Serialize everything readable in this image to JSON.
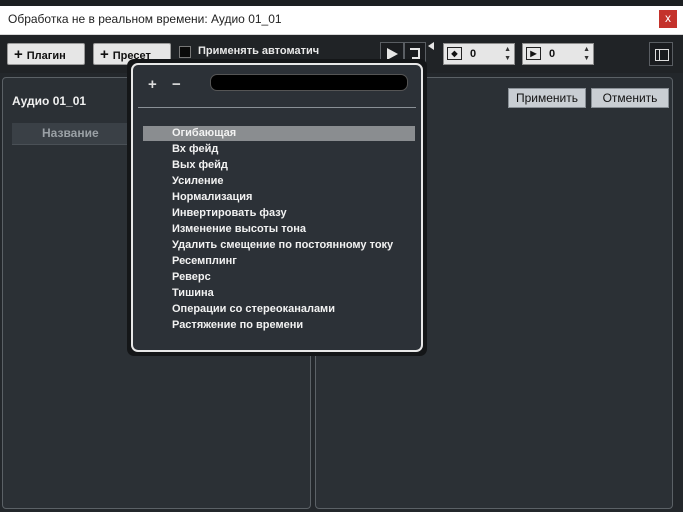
{
  "window": {
    "title": "Обработка не в реальном времени: Аудио 01_01",
    "close_label": "x"
  },
  "toolbar": {
    "plugin_label": "Плагин",
    "preset_label": "Пресет",
    "auto_apply_label": "Применять автоматич",
    "spin1_value": "0",
    "spin2_value": "0"
  },
  "left_panel": {
    "title": "Аудио 01_01",
    "column_header": "Название"
  },
  "right_panel": {
    "apply_label": "Применить",
    "cancel_label": "Отменить"
  },
  "popup": {
    "add_label": "+",
    "remove_label": "−",
    "items": [
      {
        "label": "Огибающая",
        "selected": true
      },
      {
        "label": "Вх  фейд"
      },
      {
        "label": "Вых  фейд"
      },
      {
        "label": "Усиление"
      },
      {
        "label": "Нормализация"
      },
      {
        "label": "Инвертировать фазу"
      },
      {
        "label": "Изменение высоты тона"
      },
      {
        "label": "Удалить смещение по постоянному току"
      },
      {
        "label": "Ресемплинг"
      },
      {
        "label": "Реверс"
      },
      {
        "label": "Тишина"
      },
      {
        "label": "Операции со стереоканалами"
      },
      {
        "label": "Растяжение по времени"
      }
    ]
  }
}
